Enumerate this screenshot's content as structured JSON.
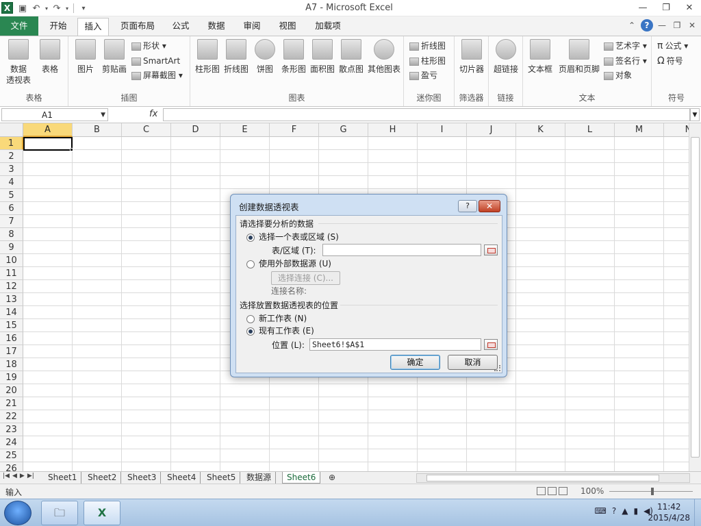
{
  "title": {
    "text": "A7  -  Microsoft Excel",
    "logo": "X"
  },
  "ribbon_tabs": [
    "文件",
    "开始",
    "插入",
    "页面布局",
    "公式",
    "数据",
    "审阅",
    "视图",
    "加载项"
  ],
  "ribbon": {
    "groups": {
      "tables": "表格",
      "illustrations": "插图",
      "charts": "图表",
      "sparklines": "迷你图",
      "filter": "筛选器",
      "links": "链接",
      "text": "文本",
      "symbols": "符号"
    },
    "buttons": {
      "pivot_line1": "数据",
      "pivot_line2": "透视表",
      "table": "表格",
      "picture": "图片",
      "clipart": "剪贴画",
      "shapes": "形状",
      "smartart": "SmartArt",
      "screenshot": "屏幕截图",
      "column": "柱形图",
      "line": "折线图",
      "pie": "饼图",
      "bar": "条形图",
      "area": "面积图",
      "scatter": "散点图",
      "other_charts": "其他图表",
      "spark_line": "折线图",
      "spark_column": "柱形图",
      "spark_winloss": "盈亏",
      "slicer": "切片器",
      "hyperlink": "超链接",
      "textbox": "文本框",
      "header_footer": "页眉和页脚",
      "wordart": "艺术字",
      "signature": "签名行",
      "object": "对象",
      "equation": "公式",
      "symbol": "符号"
    }
  },
  "formula_bar": {
    "name_box": "A1",
    "fx": "fx",
    "value": ""
  },
  "grid": {
    "columns": [
      "A",
      "B",
      "C",
      "D",
      "E",
      "F",
      "G",
      "H",
      "I",
      "J",
      "K",
      "L",
      "M",
      "N"
    ],
    "rows": [
      "1",
      "2",
      "3",
      "4",
      "5",
      "6",
      "7",
      "8",
      "9",
      "10",
      "11",
      "12",
      "13",
      "14",
      "15",
      "16",
      "17",
      "18",
      "19",
      "20",
      "21",
      "22",
      "23",
      "24",
      "25",
      "26"
    ],
    "selected_cell": "A1"
  },
  "sheets": [
    "Sheet1",
    "Sheet2",
    "Sheet3",
    "Sheet4",
    "Sheet5",
    "数据源",
    "Sheet6"
  ],
  "active_sheet": "Sheet6",
  "status": {
    "mode": "输入",
    "zoom": "100%"
  },
  "taskbar": {
    "time": "11:42",
    "date": "2015/4/28"
  },
  "dialog": {
    "title": "创建数据透视表",
    "help": "?",
    "close": "✕",
    "section1": "请选择要分析的数据",
    "radio_table": "选择一个表或区域 (S)",
    "range_label": "表/区域 (T):",
    "range_value": "",
    "radio_external": "使用外部数据源 (U)",
    "choose_connection": "选择连接 (C)...",
    "connection_name": "连接名称:",
    "section2": "选择放置数据透视表的位置",
    "radio_new": "新工作表 (N)",
    "radio_existing": "现有工作表 (E)",
    "location_label": "位置 (L):",
    "location_value": "Sheet6!$A$1",
    "ok": "确定",
    "cancel": "取消"
  }
}
